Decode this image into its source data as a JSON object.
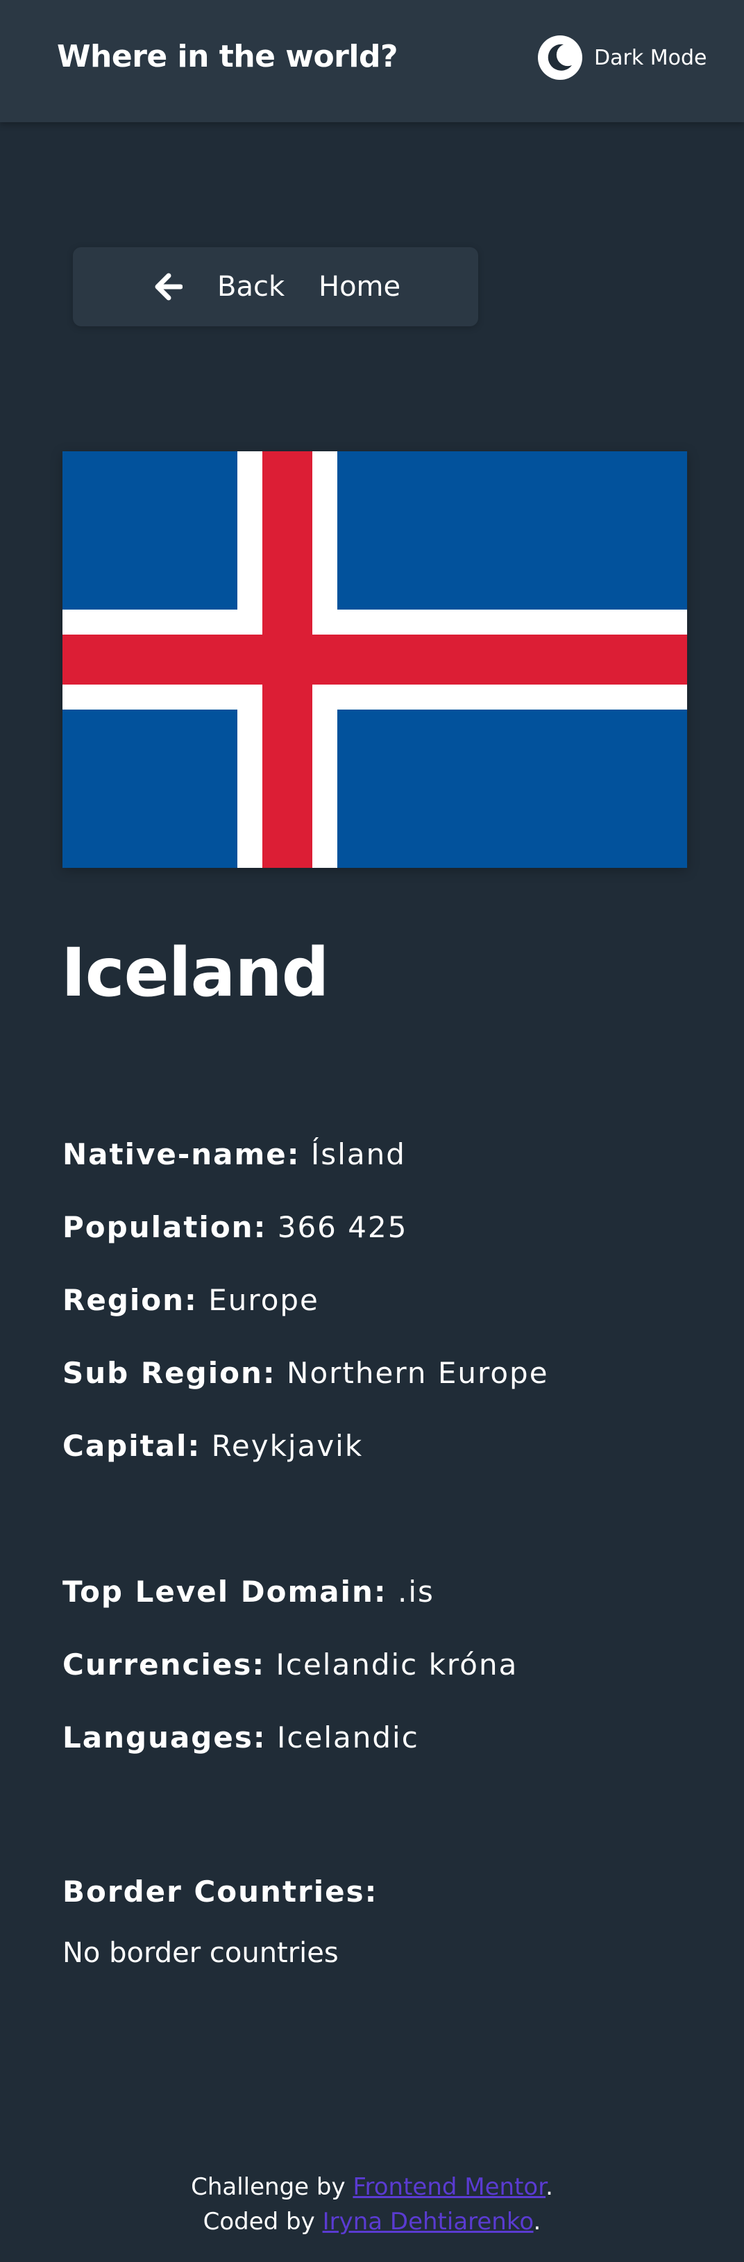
{
  "header": {
    "title": "Where in the world?",
    "theme_toggle_label": "Dark Mode",
    "theme_icon": "moon-icon"
  },
  "nav": {
    "back_label": "Back",
    "back_icon": "arrow-left-icon",
    "home_label": "Home"
  },
  "country": {
    "name": "Iceland",
    "flag_icon": "iceland-flag",
    "flag_colors": {
      "blue": "#02529c",
      "white": "#ffffff",
      "red": "#dc1e35"
    },
    "details_primary": [
      {
        "label": "Native-name:",
        "value": "Ísland"
      },
      {
        "label": "Population:",
        "value": "366 425"
      },
      {
        "label": "Region:",
        "value": "Europe"
      },
      {
        "label": "Sub Region:",
        "value": "Northern Europe"
      },
      {
        "label": "Capital:",
        "value": "Reykjavik"
      }
    ],
    "details_secondary": [
      {
        "label": "Top Level Domain:",
        "value": ".is"
      },
      {
        "label": "Currencies:",
        "value": "Icelandic króna"
      },
      {
        "label": "Languages:",
        "value": "Icelandic"
      }
    ],
    "border_countries_label": "Border Countries:",
    "border_countries_empty": "No border countries"
  },
  "footer": {
    "line1_prefix": "Challenge by ",
    "line1_link": "Frontend Mentor",
    "line1_suffix": ".",
    "line2_prefix": "Coded by ",
    "line2_link": "Iryna Dehtiarenko",
    "line2_suffix": "."
  },
  "colors": {
    "background": "#202c37",
    "surface": "#2b3844",
    "text": "#ffffff",
    "link": "#5a3bd1"
  }
}
